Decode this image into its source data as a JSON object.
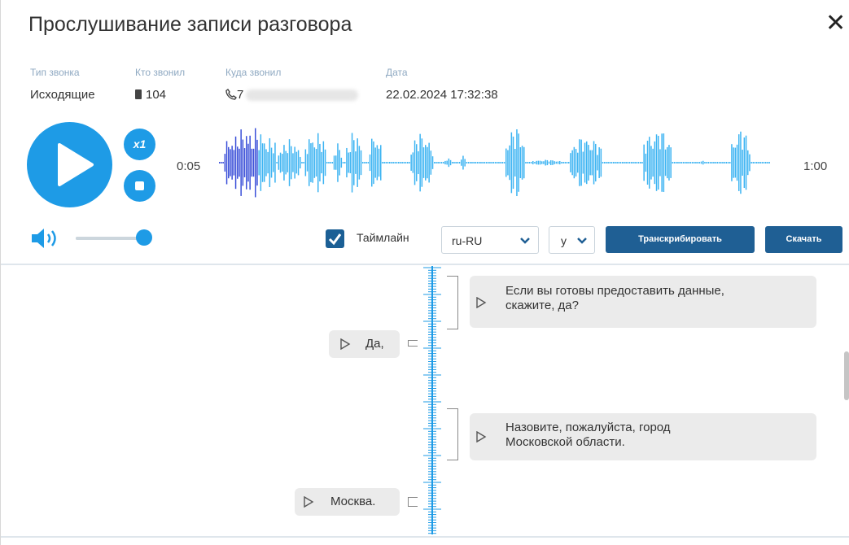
{
  "dialog": {
    "title": "Прослушивание записи разговора",
    "close_icon": "close-icon"
  },
  "meta": {
    "call_type_label": "Тип звонка",
    "call_type_value": "Исходящие",
    "caller_label": "Кто звонил",
    "caller_value": "104",
    "callee_label": "Куда звонил",
    "callee_value": "7",
    "date_label": "Дата",
    "date_value": "22.02.2024 17:32:38"
  },
  "player": {
    "speed_label": "x1",
    "current_time": "0:05",
    "total_time": "1:00",
    "progress_fraction": 0.083,
    "volume_fraction": 1.0,
    "colors": {
      "accent": "#1e9be6",
      "played": "#3a4fd8",
      "wave": "#3db4f2",
      "dark_button": "#1f5f94"
    }
  },
  "controls": {
    "timeline_checkbox_checked": true,
    "timeline_label": "Таймлайн",
    "language_value": "ru-RU",
    "second_select_value": "у",
    "transcribe_label": "Транскрибировать",
    "download_label": "Скачать"
  },
  "transcript": [
    {
      "speaker": "right",
      "text_line1": "Если вы готовы предоставить данные,",
      "text_line2": "скажите, да?"
    },
    {
      "speaker": "left",
      "text_line1": "Да,"
    },
    {
      "speaker": "right",
      "text_line1": "Назовите, пожалуйста, город",
      "text_line2": "Московской области."
    },
    {
      "speaker": "left",
      "text_line1": "Москва."
    }
  ]
}
